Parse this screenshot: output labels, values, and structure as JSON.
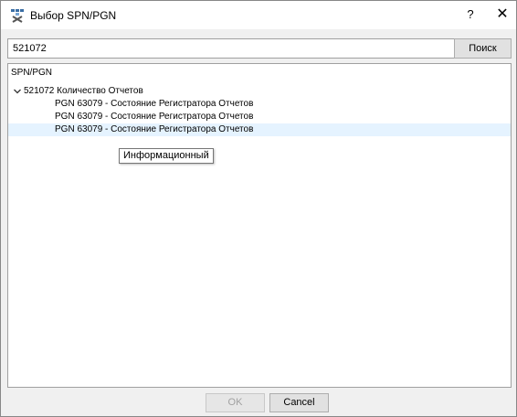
{
  "window": {
    "title": "Выбор SPN/PGN",
    "help_label": "?",
    "close_label": "✕"
  },
  "search": {
    "value": "521072",
    "button_label": "Поиск"
  },
  "tree": {
    "header": "SPN/PGN",
    "root": {
      "label": "521072 Количество Отчетов",
      "expanded": true,
      "children": [
        {
          "label": "PGN 63079 - Состояние Регистратора Отчетов"
        },
        {
          "label": "PGN 63079 - Состояние Регистратора Отчетов"
        },
        {
          "label": "PGN 63079 - Состояние Регистратора Отчетов",
          "selected": true
        }
      ]
    }
  },
  "tooltip": {
    "text": "Информационный"
  },
  "footer": {
    "ok_label": "OK",
    "ok_enabled": false,
    "cancel_label": "Cancel"
  },
  "colors": {
    "selection": "#e5f3ff",
    "titlebar": "#ffffff",
    "dialog_bg": "#f0f0f0"
  }
}
